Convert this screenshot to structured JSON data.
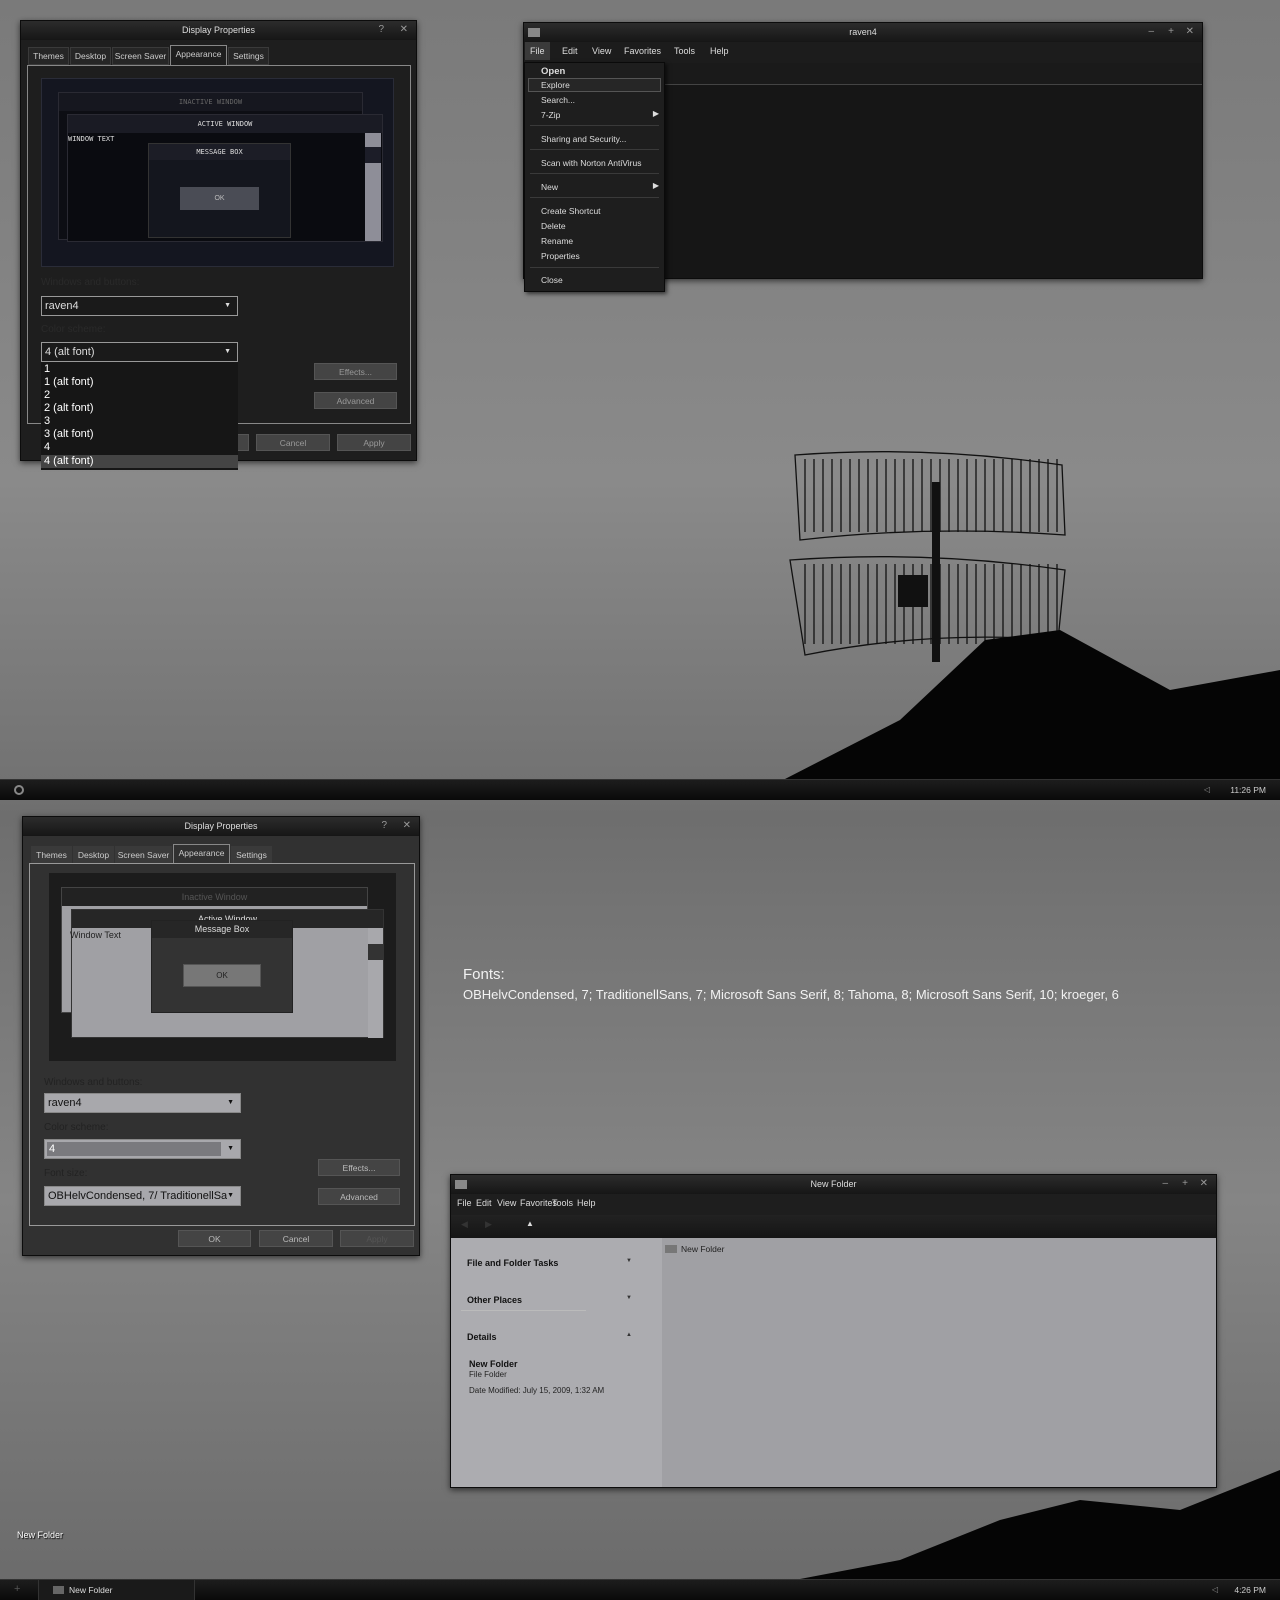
{
  "top_dialog": {
    "title": "Display Properties",
    "help": "?",
    "close": "✕",
    "tabs": [
      "Themes",
      "Desktop",
      "Screen Saver",
      "Appearance",
      "Settings"
    ],
    "active_tab": "Appearance",
    "preview": {
      "inactive": "INACTIVE WINDOW",
      "active": "ACTIVE WINDOW",
      "window_text": "WINDOW TEXT",
      "message_box": "MESSAGE BOX",
      "ok": "OK"
    },
    "windows_label": "Windows and buttons:",
    "windows_value": "raven4",
    "scheme_label": "Color scheme:",
    "scheme_value": "4 (alt font)",
    "scheme_options": [
      "1",
      "1 (alt font)",
      "2",
      "2 (alt font)",
      "3",
      "3 (alt font)",
      "4",
      "4 (alt font)"
    ],
    "effects": "Effects...",
    "advanced": "Advanced",
    "ok": "OK",
    "cancel": "Cancel",
    "apply": "Apply"
  },
  "top_explorer": {
    "title": "raven4",
    "menus": [
      "File",
      "Edit",
      "View",
      "Favorites",
      "Tools",
      "Help"
    ],
    "file_menu": {
      "open": "Open",
      "explore": "Explore",
      "search": "Search...",
      "zip": "7-Zip",
      "sharing": "Sharing and Security...",
      "scan": "Scan with Norton AntiVirus",
      "new": "New",
      "shortcut": "Create Shortcut",
      "delete": "Delete",
      "rename": "Rename",
      "properties": "Properties",
      "close": "Close"
    }
  },
  "top_taskbar": {
    "clock": "11:26 PM"
  },
  "fonts_note": {
    "heading": "Fonts:",
    "list": "OBHelvCondensed, 7; TraditionellSans, 7; Microsoft Sans Serif, 8; Tahoma, 8; Microsoft Sans Serif, 10; kroeger, 6"
  },
  "bottom_dialog": {
    "title": "Display Properties",
    "help": "?",
    "close": "✕",
    "tabs": [
      "Themes",
      "Desktop",
      "Screen Saver",
      "Appearance",
      "Settings"
    ],
    "preview": {
      "inactive": "Inactive Window",
      "active": "Active Window",
      "window_text": "Window Text",
      "message_box": "Message Box",
      "ok": "OK"
    },
    "windows_label": "Windows and buttons:",
    "windows_value": "raven4",
    "scheme_label": "Color scheme:",
    "scheme_value": "4",
    "font_label": "Font size:",
    "font_value": "OBHelvCondensed, 7/ TraditionellSa",
    "effects": "Effects...",
    "advanced": "Advanced",
    "ok": "OK",
    "cancel": "Cancel",
    "apply": "Apply"
  },
  "bottom_explorer": {
    "title": "New Folder",
    "menus": [
      "File",
      "Edit",
      "View",
      "Favorites",
      "Tools",
      "Help"
    ],
    "tasks": [
      "File and Folder Tasks",
      "Other Places",
      "Details"
    ],
    "details": {
      "name": "New Folder",
      "type": "File Folder",
      "modified": "Date Modified: July 15, 2009, 1:32 AM"
    },
    "item": "New Folder"
  },
  "desktop_icon": "New Folder",
  "bottom_taskbar": {
    "task": "New Folder",
    "clock": "4:26 PM"
  }
}
